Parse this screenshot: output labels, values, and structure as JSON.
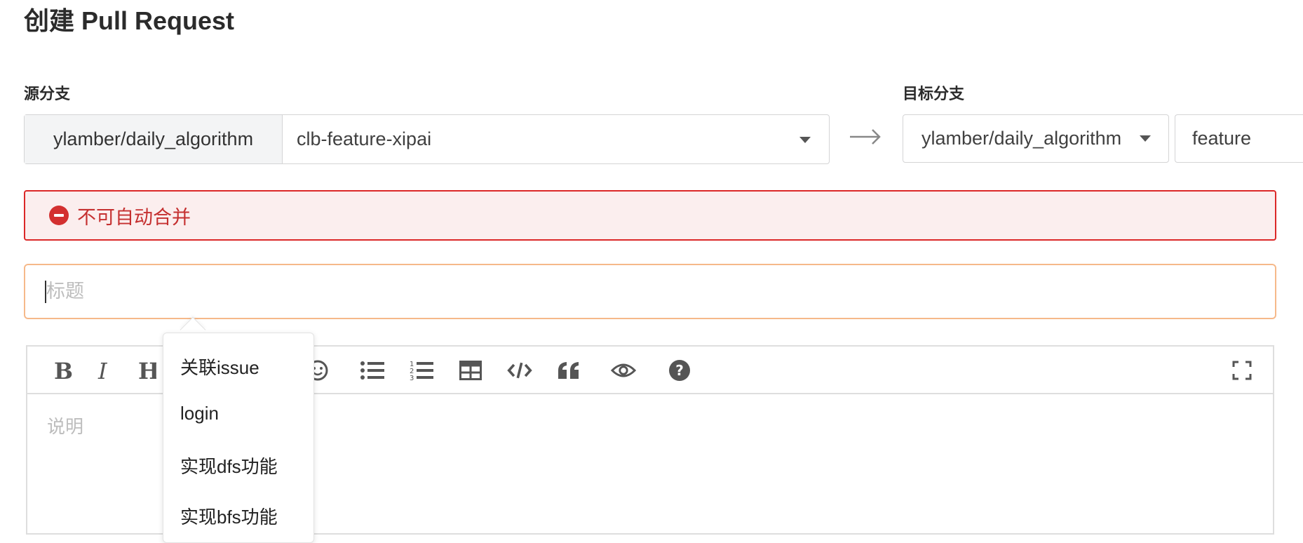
{
  "page": {
    "title": "创建 Pull Request"
  },
  "source": {
    "label": "源分支",
    "repo": "ylamber/daily_algorithm",
    "branch": "clb-feature-xipai"
  },
  "target": {
    "label": "目标分支",
    "repo": "ylamber/daily_algorithm",
    "branch": "feature"
  },
  "alert": {
    "text": "不可自动合并",
    "color": "#db2828"
  },
  "title_input": {
    "placeholder": "标题",
    "value": ""
  },
  "editor": {
    "placeholder": "说明",
    "toolbar": [
      "bold-icon",
      "italic-icon",
      "heading-icon",
      "emoji-icon",
      "unordered-list-icon",
      "ordered-list-icon",
      "table-icon",
      "code-icon",
      "quote-icon",
      "preview-icon",
      "help-icon",
      "fullscreen-icon"
    ]
  },
  "mention_dropdown": {
    "items": [
      "关联issue",
      "login",
      "实现dfs功能",
      "实现bfs功能"
    ]
  }
}
